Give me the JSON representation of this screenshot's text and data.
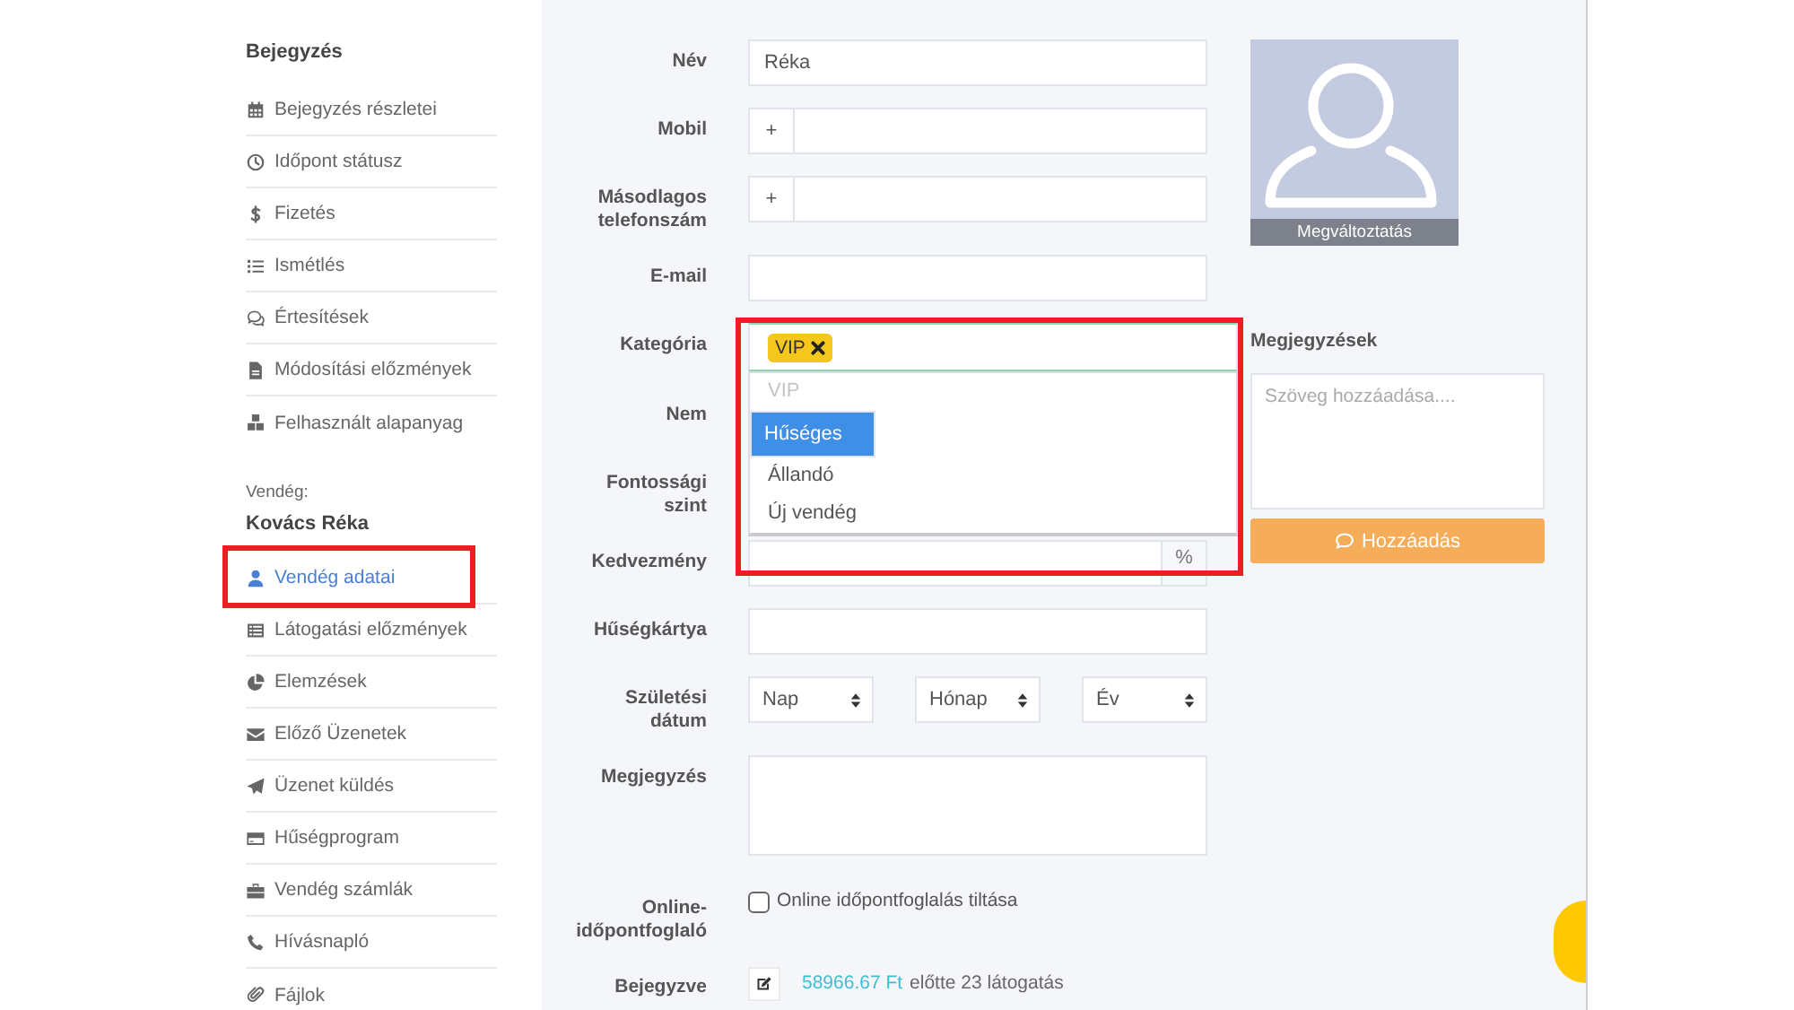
{
  "sidebar": {
    "sections": [
      {
        "title": "Bejegyzés",
        "items": [
          {
            "label": "Bejegyzés részletei",
            "selected": false,
            "highlighted": false
          },
          {
            "label": "Időpont státusz",
            "selected": false,
            "highlighted": false
          },
          {
            "label": "Fizetés",
            "selected": false,
            "highlighted": false
          },
          {
            "label": "Ismétlés",
            "selected": false,
            "highlighted": false
          },
          {
            "label": "Értesítések",
            "selected": false,
            "highlighted": false
          },
          {
            "label": "Módosítási előzmények",
            "selected": false,
            "highlighted": false
          },
          {
            "label": "Felhasznált alapanyag",
            "selected": false,
            "highlighted": false
          }
        ]
      },
      {
        "caption": "Vendég:",
        "title": "Kovács Réka",
        "items": [
          {
            "label": "Vendég adatai",
            "selected": true,
            "highlighted": true
          },
          {
            "label": "Látogatási előzmények",
            "selected": false,
            "highlighted": false
          },
          {
            "label": "Elemzések",
            "selected": false,
            "highlighted": false
          },
          {
            "label": "Előző Üzenetek",
            "selected": false,
            "highlighted": false
          },
          {
            "label": "Üzenet küldés",
            "selected": false,
            "highlighted": false
          },
          {
            "label": "Hűségprogram",
            "selected": false,
            "highlighted": false
          },
          {
            "label": "Vendég számlák",
            "selected": false,
            "highlighted": false
          },
          {
            "label": "Hívásnapló",
            "selected": false,
            "highlighted": false
          },
          {
            "label": "Fájlok",
            "selected": false,
            "highlighted": false
          }
        ]
      }
    ]
  },
  "form": {
    "fields": [
      {
        "kind": "text",
        "label": "Név",
        "value": "Réka",
        "highlighted": false
      },
      {
        "kind": "prefix",
        "label": "Mobil",
        "prefix": "+",
        "highlighted": false
      },
      {
        "kind": "prefix",
        "label": "Másodlagos telefonszám",
        "prefix": "+",
        "highlighted": false
      },
      {
        "kind": "text",
        "label": "E-mail",
        "highlighted": false
      },
      {
        "kind": "tags",
        "label": "Kategória",
        "tags": [
          "VIP"
        ],
        "highlighted": true,
        "dropdown": {
          "options": [
            {
              "label": "VIP",
              "disabled": true,
              "selected": false
            },
            {
              "label": "Hűséges",
              "disabled": false,
              "selected": true
            },
            {
              "label": "Állandó",
              "disabled": false,
              "selected": false
            },
            {
              "label": "Új vendég",
              "disabled": false,
              "selected": false
            }
          ]
        }
      },
      {
        "kind": "covered",
        "label": "Nem",
        "highlighted": false
      },
      {
        "kind": "covered",
        "label": "Fontossági szint",
        "highlighted": false
      },
      {
        "kind": "suffix",
        "label": "Kedvezmény",
        "suffix": "%",
        "highlighted": false
      },
      {
        "kind": "text",
        "label": "Hűségkártya",
        "highlighted": false
      },
      {
        "kind": "date",
        "label": "Születési dátum",
        "selects": [
          {
            "value": "Nap"
          },
          {
            "value": "Hónap"
          },
          {
            "value": "Év"
          }
        ],
        "highlighted": false
      },
      {
        "kind": "textarea",
        "label": "Megjegyzés",
        "highlighted": false
      },
      {
        "kind": "checkbox",
        "label": "Online-időpontfoglaló",
        "option": "Online időpontfoglalás tiltása",
        "checked": false,
        "highlighted": false
      },
      {
        "kind": "info",
        "label": "Bejegyzve",
        "amount": "58966.67 Ft",
        "text": "előtte 23 látogatás",
        "highlighted": false
      }
    ]
  },
  "photo": {
    "button": "Megváltoztatás"
  },
  "notes": {
    "title": "Megjegyzések",
    "placeholder": "Szöveg hozzáadása....",
    "button": "Hozzáadás"
  }
}
